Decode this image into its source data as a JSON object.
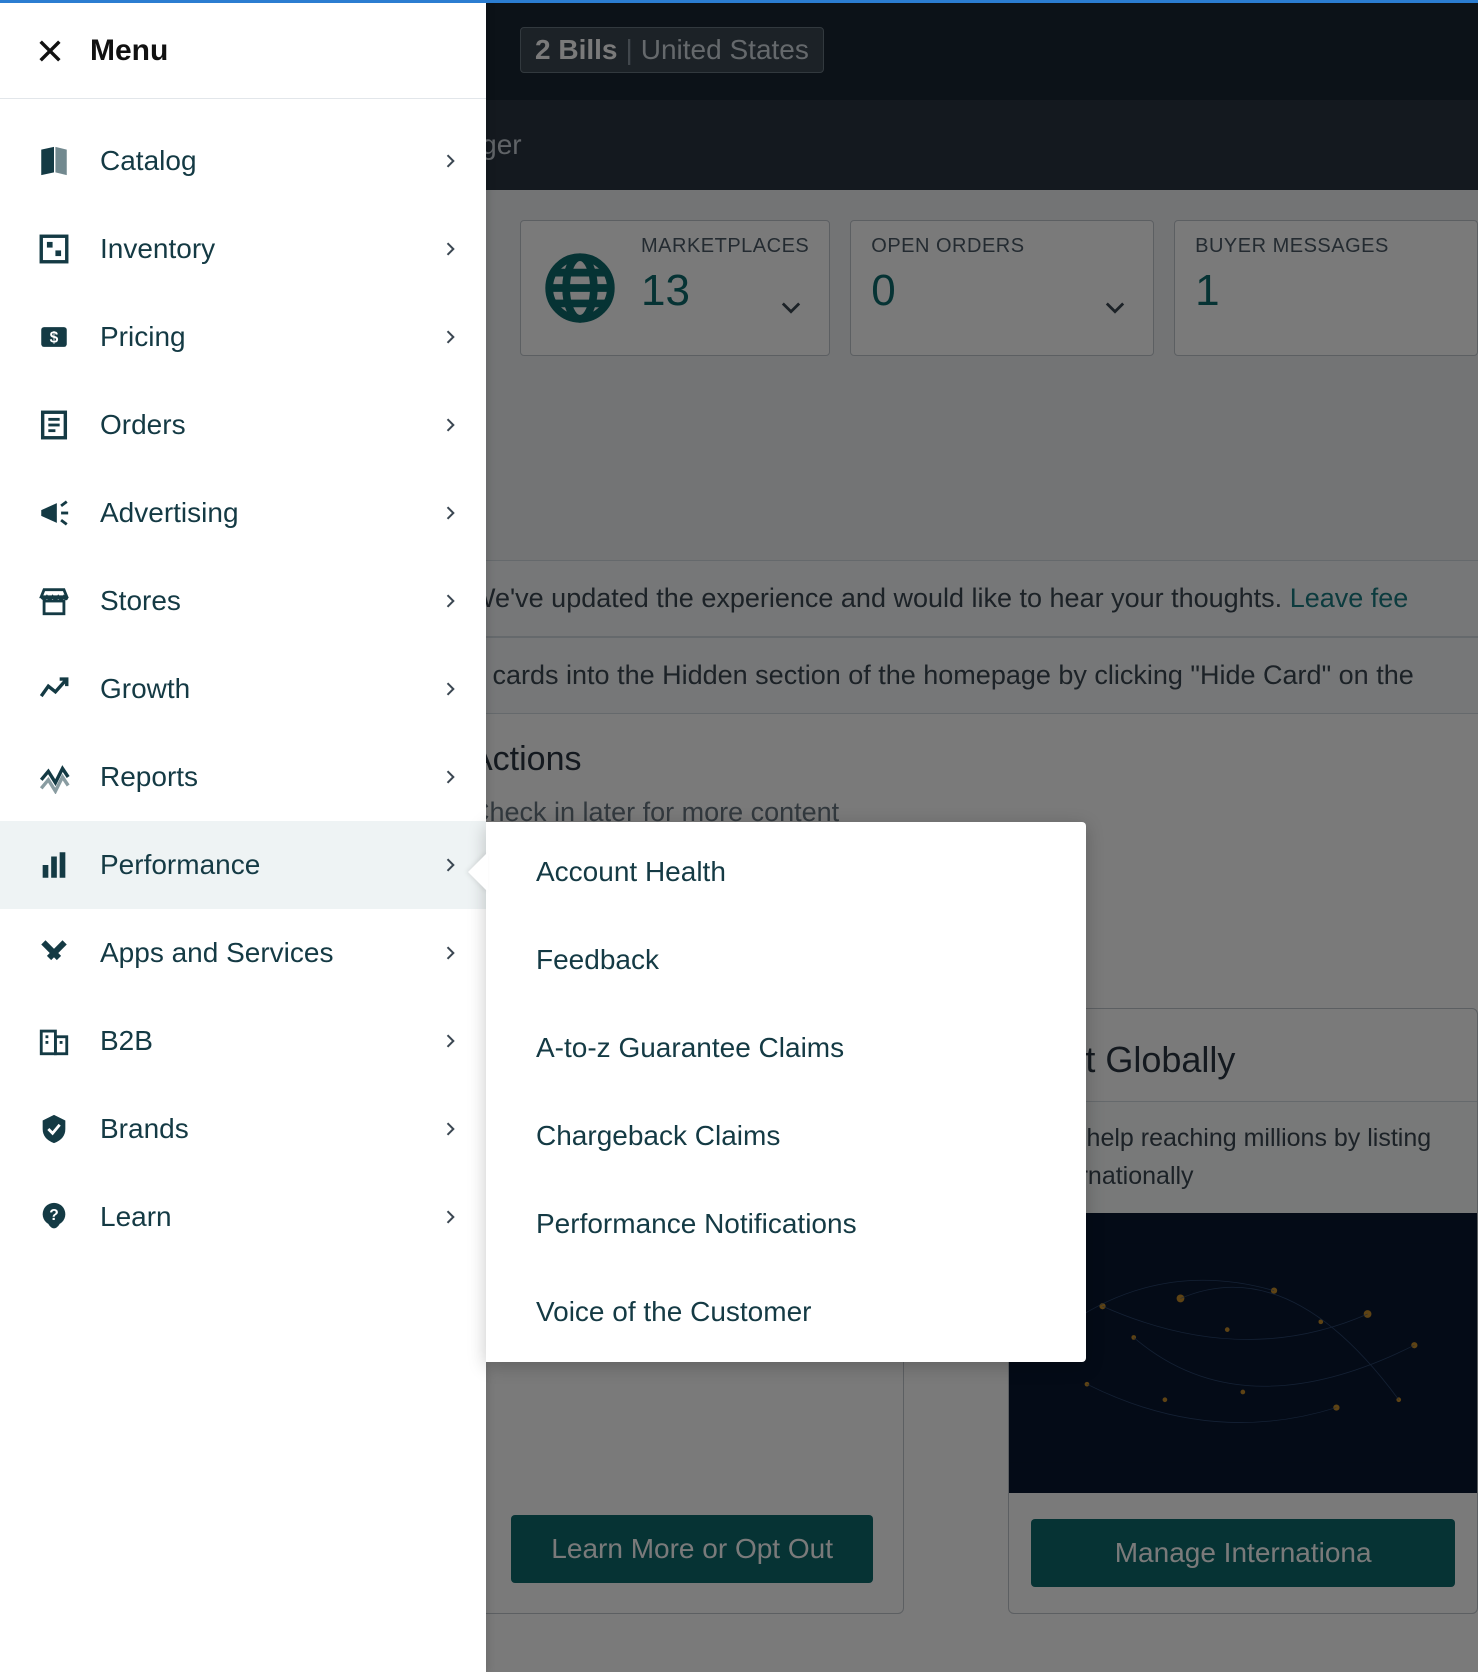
{
  "header": {
    "bills_count": "2 Bills",
    "bills_location": "United States",
    "sub_header_text": "nager"
  },
  "stats": {
    "marketplaces": {
      "label": "MARKETPLACES",
      "value": "13"
    },
    "open_orders": {
      "label": "OPEN ORDERS",
      "value": "0"
    },
    "buyer_messages": {
      "label": "BUYER MESSAGES",
      "value": "1"
    }
  },
  "notice1_prefix": "We've updated the experience and would like to hear your thoughts. ",
  "notice1_link": "Leave fee",
  "notice2": "e cards into the Hidden section of the homepage by clicking \"Hide Card\" on the",
  "actions": {
    "title": "Actions",
    "sub": "Check in later for more content"
  },
  "card_left": {
    "button": "Learn More or Opt Out"
  },
  "card_right": {
    "title": "List Globally",
    "sub": "Get help reaching millions  by listing internationally",
    "button": "Manage Internationa"
  },
  "menu": {
    "title": "Menu",
    "items": [
      {
        "label": "Catalog"
      },
      {
        "label": "Inventory"
      },
      {
        "label": "Pricing"
      },
      {
        "label": "Orders"
      },
      {
        "label": "Advertising"
      },
      {
        "label": "Stores"
      },
      {
        "label": "Growth"
      },
      {
        "label": "Reports"
      },
      {
        "label": "Performance"
      },
      {
        "label": "Apps and Services"
      },
      {
        "label": "B2B"
      },
      {
        "label": "Brands"
      },
      {
        "label": "Learn"
      }
    ]
  },
  "submenu": [
    "Account Health",
    "Feedback",
    "A-to-z Guarantee Claims",
    "Chargeback Claims",
    "Performance Notifications",
    "Voice of the Customer"
  ]
}
